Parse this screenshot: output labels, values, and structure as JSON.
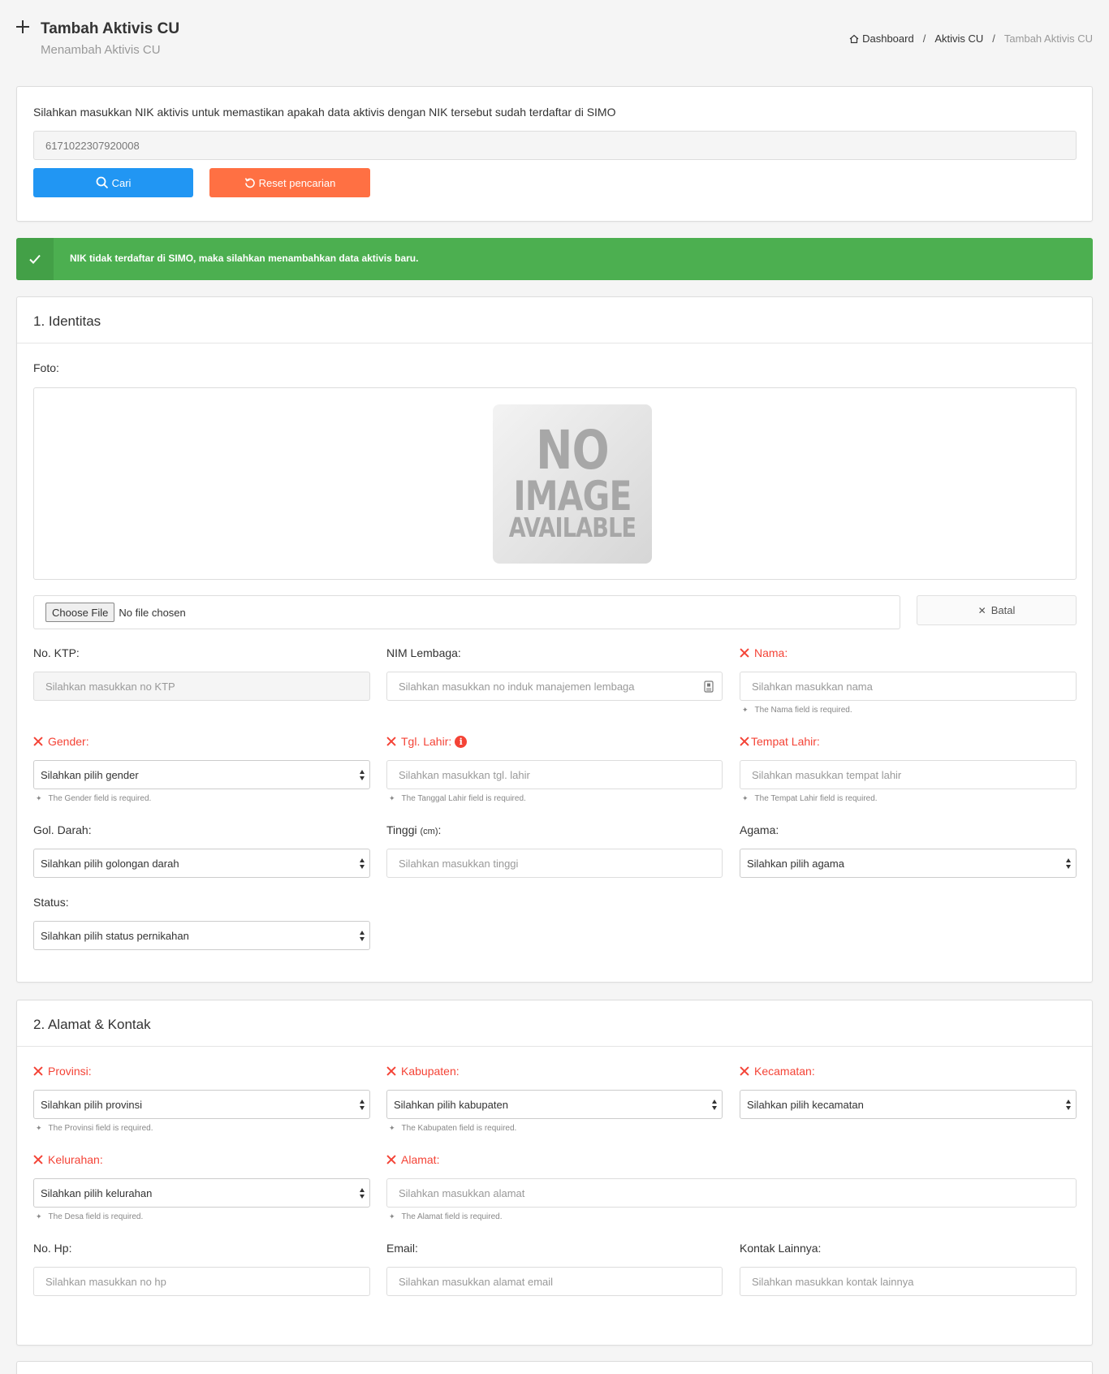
{
  "header": {
    "title": "Tambah Aktivis CU",
    "subtitle": "Menambah Aktivis CU",
    "breadcrumb": [
      "Dashboard",
      "Aktivis CU",
      "Tambah Aktivis CU"
    ],
    "separator": "/"
  },
  "search": {
    "description": "Silahkan masukkan NIK aktivis untuk memastikan apakah data aktivis dengan NIK tersebut sudah terdaftar di SIMO",
    "nik_value": "6171022307920008",
    "search_button": "Cari",
    "reset_button": "Reset pencarian",
    "search_color": "#2196f3",
    "reset_color": "#ff7043"
  },
  "alert": {
    "message": "NIK tidak terdaftar di SIMO, maka silahkan menambahkan data aktivis baru.",
    "color": "#4caf50"
  },
  "identitas": {
    "title": "1. Identitas",
    "foto_label": "Foto:",
    "no_image_lines": [
      "NO",
      "IMAGE",
      "AVAILABLE"
    ],
    "file_button": "Choose File",
    "file_status": "No file chosen",
    "batal_button": "Batal",
    "fields": {
      "no_ktp": {
        "label": "No. KTP:",
        "placeholder": "Silahkan masukkan no KTP"
      },
      "nim": {
        "label": "NIM Lembaga:",
        "placeholder": "Silahkan masukkan no induk manajemen lembaga"
      },
      "nama": {
        "label": "Nama:",
        "placeholder": "Silahkan masukkan nama",
        "error": "The Nama field is required."
      },
      "gender": {
        "label": "Gender:",
        "selected": "Silahkan pilih gender",
        "error": "The Gender field is required."
      },
      "tgl_lahir": {
        "label": "Tgl. Lahir:",
        "placeholder": "Silahkan masukkan tgl. lahir",
        "error": "The Tanggal Lahir field is required."
      },
      "tempat_lahir": {
        "label": "Tempat Lahir:",
        "placeholder": "Silahkan masukkan tempat lahir",
        "error": "The Tempat Lahir field is required."
      },
      "gol_darah": {
        "label": "Gol. Darah:",
        "selected": "Silahkan pilih golongan darah"
      },
      "tinggi": {
        "label": "Tinggi",
        "unit": "(cm)",
        "colon": ":",
        "placeholder": "Silahkan masukkan tinggi"
      },
      "agama": {
        "label": "Agama:",
        "selected": "Silahkan pilih agama"
      },
      "status": {
        "label": "Status:",
        "selected": "Silahkan pilih status pernikahan"
      }
    }
  },
  "alamat": {
    "title": "2. Alamat & Kontak",
    "fields": {
      "provinsi": {
        "label": "Provinsi:",
        "selected": "Silahkan pilih provinsi",
        "error": "The Provinsi field is required."
      },
      "kabupaten": {
        "label": "Kabupaten:",
        "selected": "Silahkan pilih kabupaten",
        "error": "The Kabupaten field is required."
      },
      "kecamatan": {
        "label": "Kecamatan:",
        "selected": "Silahkan pilih kecamatan"
      },
      "kelurahan": {
        "label": "Kelurahan:",
        "selected": "Silahkan pilih kelurahan",
        "error": "The Desa field is required."
      },
      "alamat": {
        "label": "Alamat:",
        "placeholder": "Silahkan masukkan alamat",
        "error": "The Alamat field is required."
      },
      "no_hp": {
        "label": "No. Hp:",
        "placeholder": "Silahkan masukkan no hp"
      },
      "email": {
        "label": "Email:",
        "placeholder": "Silahkan masukkan alamat email"
      },
      "kontak": {
        "label": "Kontak Lainnya:",
        "placeholder": "Silahkan masukkan kontak lainnya"
      }
    }
  }
}
